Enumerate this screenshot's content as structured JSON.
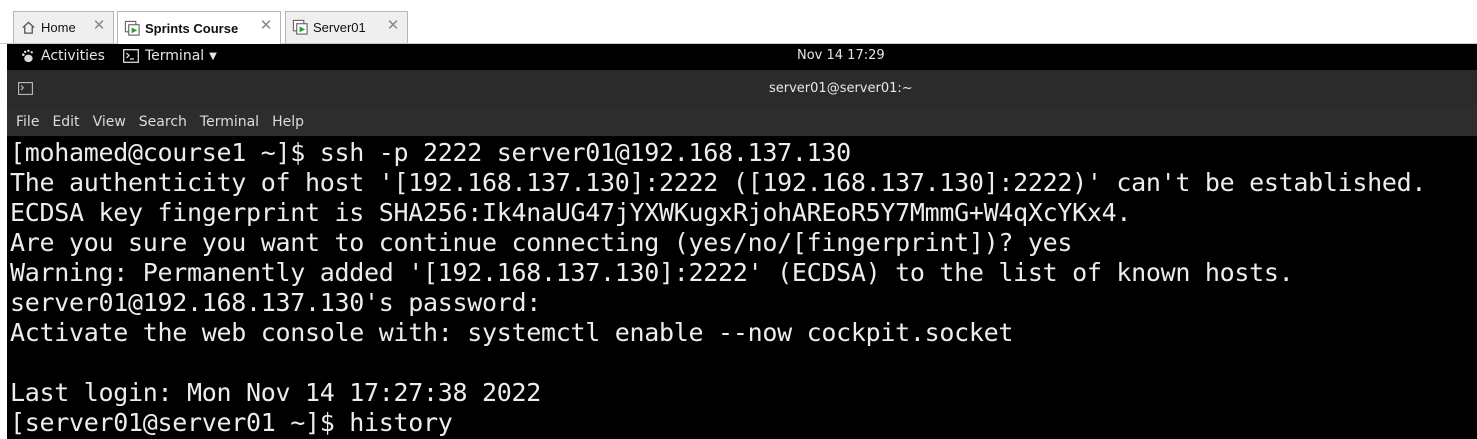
{
  "host_tabs": [
    {
      "label": "Home",
      "icon": "home-icon",
      "active": false
    },
    {
      "label": "Sprints Course",
      "icon": "vm-running-icon",
      "active": true
    },
    {
      "label": "Server01",
      "icon": "vm-running-icon",
      "active": false
    }
  ],
  "gnome_bar": {
    "activities": "Activities",
    "app_menu": "Terminal",
    "clock": "Nov 14  17:29"
  },
  "terminal": {
    "title": "server01@server01:~",
    "menu": [
      "File",
      "Edit",
      "View",
      "Search",
      "Terminal",
      "Help"
    ],
    "lines": [
      "[mohamed@course1 ~]$ ssh -p 2222 server01@192.168.137.130",
      "The authenticity of host '[192.168.137.130]:2222 ([192.168.137.130]:2222)' can't be established.",
      "ECDSA key fingerprint is SHA256:Ik4naUG47jYXWKugxRjohAREoR5Y7MmmG+W4qXcYKx4.",
      "Are you sure you want to continue connecting (yes/no/[fingerprint])? yes",
      "Warning: Permanently added '[192.168.137.130]:2222' (ECDSA) to the list of known hosts.",
      "server01@192.168.137.130's password:",
      "Activate the web console with: systemctl enable --now cockpit.socket",
      "",
      "Last login: Mon Nov 14 17:27:38 2022",
      "[server01@server01 ~]$ history"
    ]
  },
  "colors": {
    "terminal_bg": "#000000",
    "terminal_fg": "#ededed",
    "titlebar_bg": "#2b2b2b",
    "menubar_bg": "#2d2d2d"
  }
}
